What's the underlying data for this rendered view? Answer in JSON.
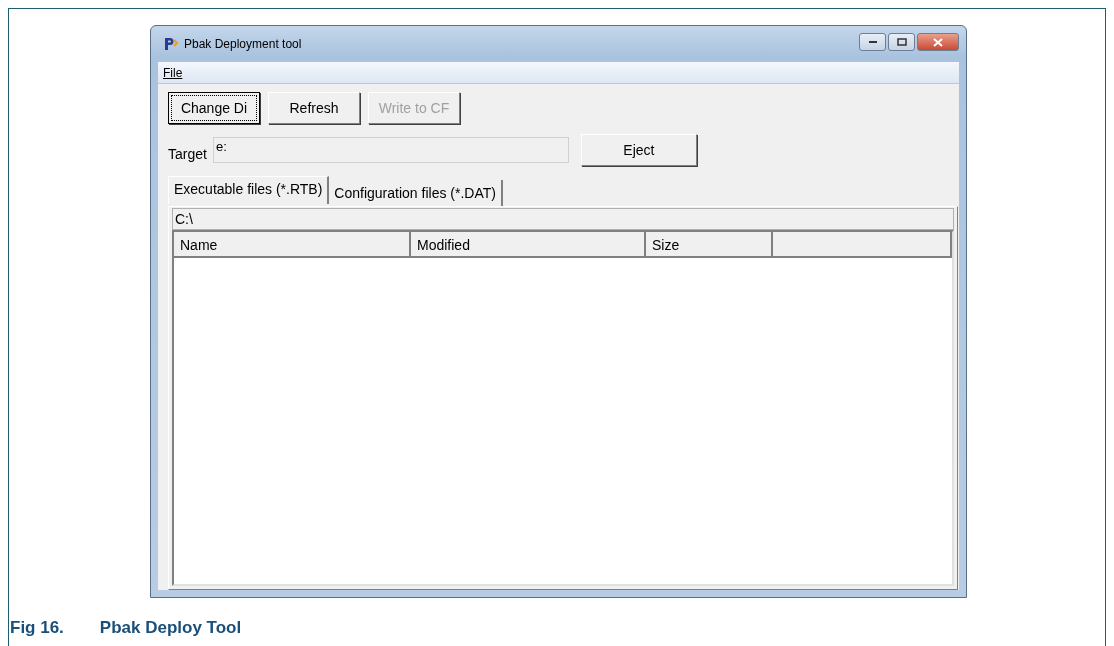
{
  "window": {
    "title": "Pbak Deployment tool"
  },
  "menu": [
    {
      "label": "File"
    }
  ],
  "toolbar": [
    {
      "label": "Change Di",
      "disabled": false,
      "focused": true
    },
    {
      "label": "Refresh",
      "disabled": false,
      "focused": false
    },
    {
      "label": "Write to CF",
      "disabled": true,
      "focused": false
    }
  ],
  "target": {
    "label": "Target",
    "value": "e:",
    "button": "Eject"
  },
  "tabs": [
    {
      "label": "Executable files (*.RTB)",
      "selected": true
    },
    {
      "label": "Configuration files (*.DAT)",
      "selected": false
    }
  ],
  "path": "C:\\",
  "table": {
    "columns": [
      "Name",
      "Modified",
      "Size"
    ]
  },
  "caption": {
    "label": "Fig 16.",
    "title": "Pbak Deploy Tool"
  }
}
